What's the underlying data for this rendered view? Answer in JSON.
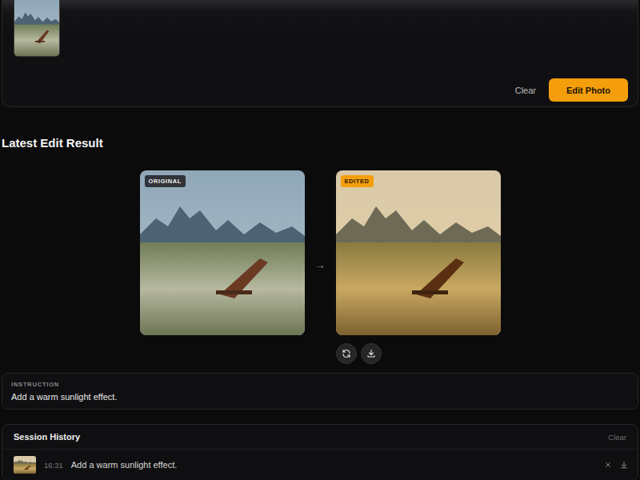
{
  "upload": {
    "buttons": [
      {
        "label": "Clear",
        "primary": false
      },
      {
        "label": "Edit Photo",
        "primary": true
      }
    ]
  },
  "result": {
    "title": "Latest Edit Result",
    "arrow": "→",
    "panels": [
      {
        "badge": "ORIGINAL",
        "warm": false
      },
      {
        "badge": "EDITED",
        "warm": true
      }
    ]
  },
  "instruction": {
    "label": "INSTRUCTION",
    "text": "Add a warm sunlight effect."
  },
  "history": {
    "title": "Session History",
    "clear": "Clear",
    "items": [
      {
        "time": "16:31",
        "text": "Add a warm sunlight effect."
      }
    ]
  }
}
